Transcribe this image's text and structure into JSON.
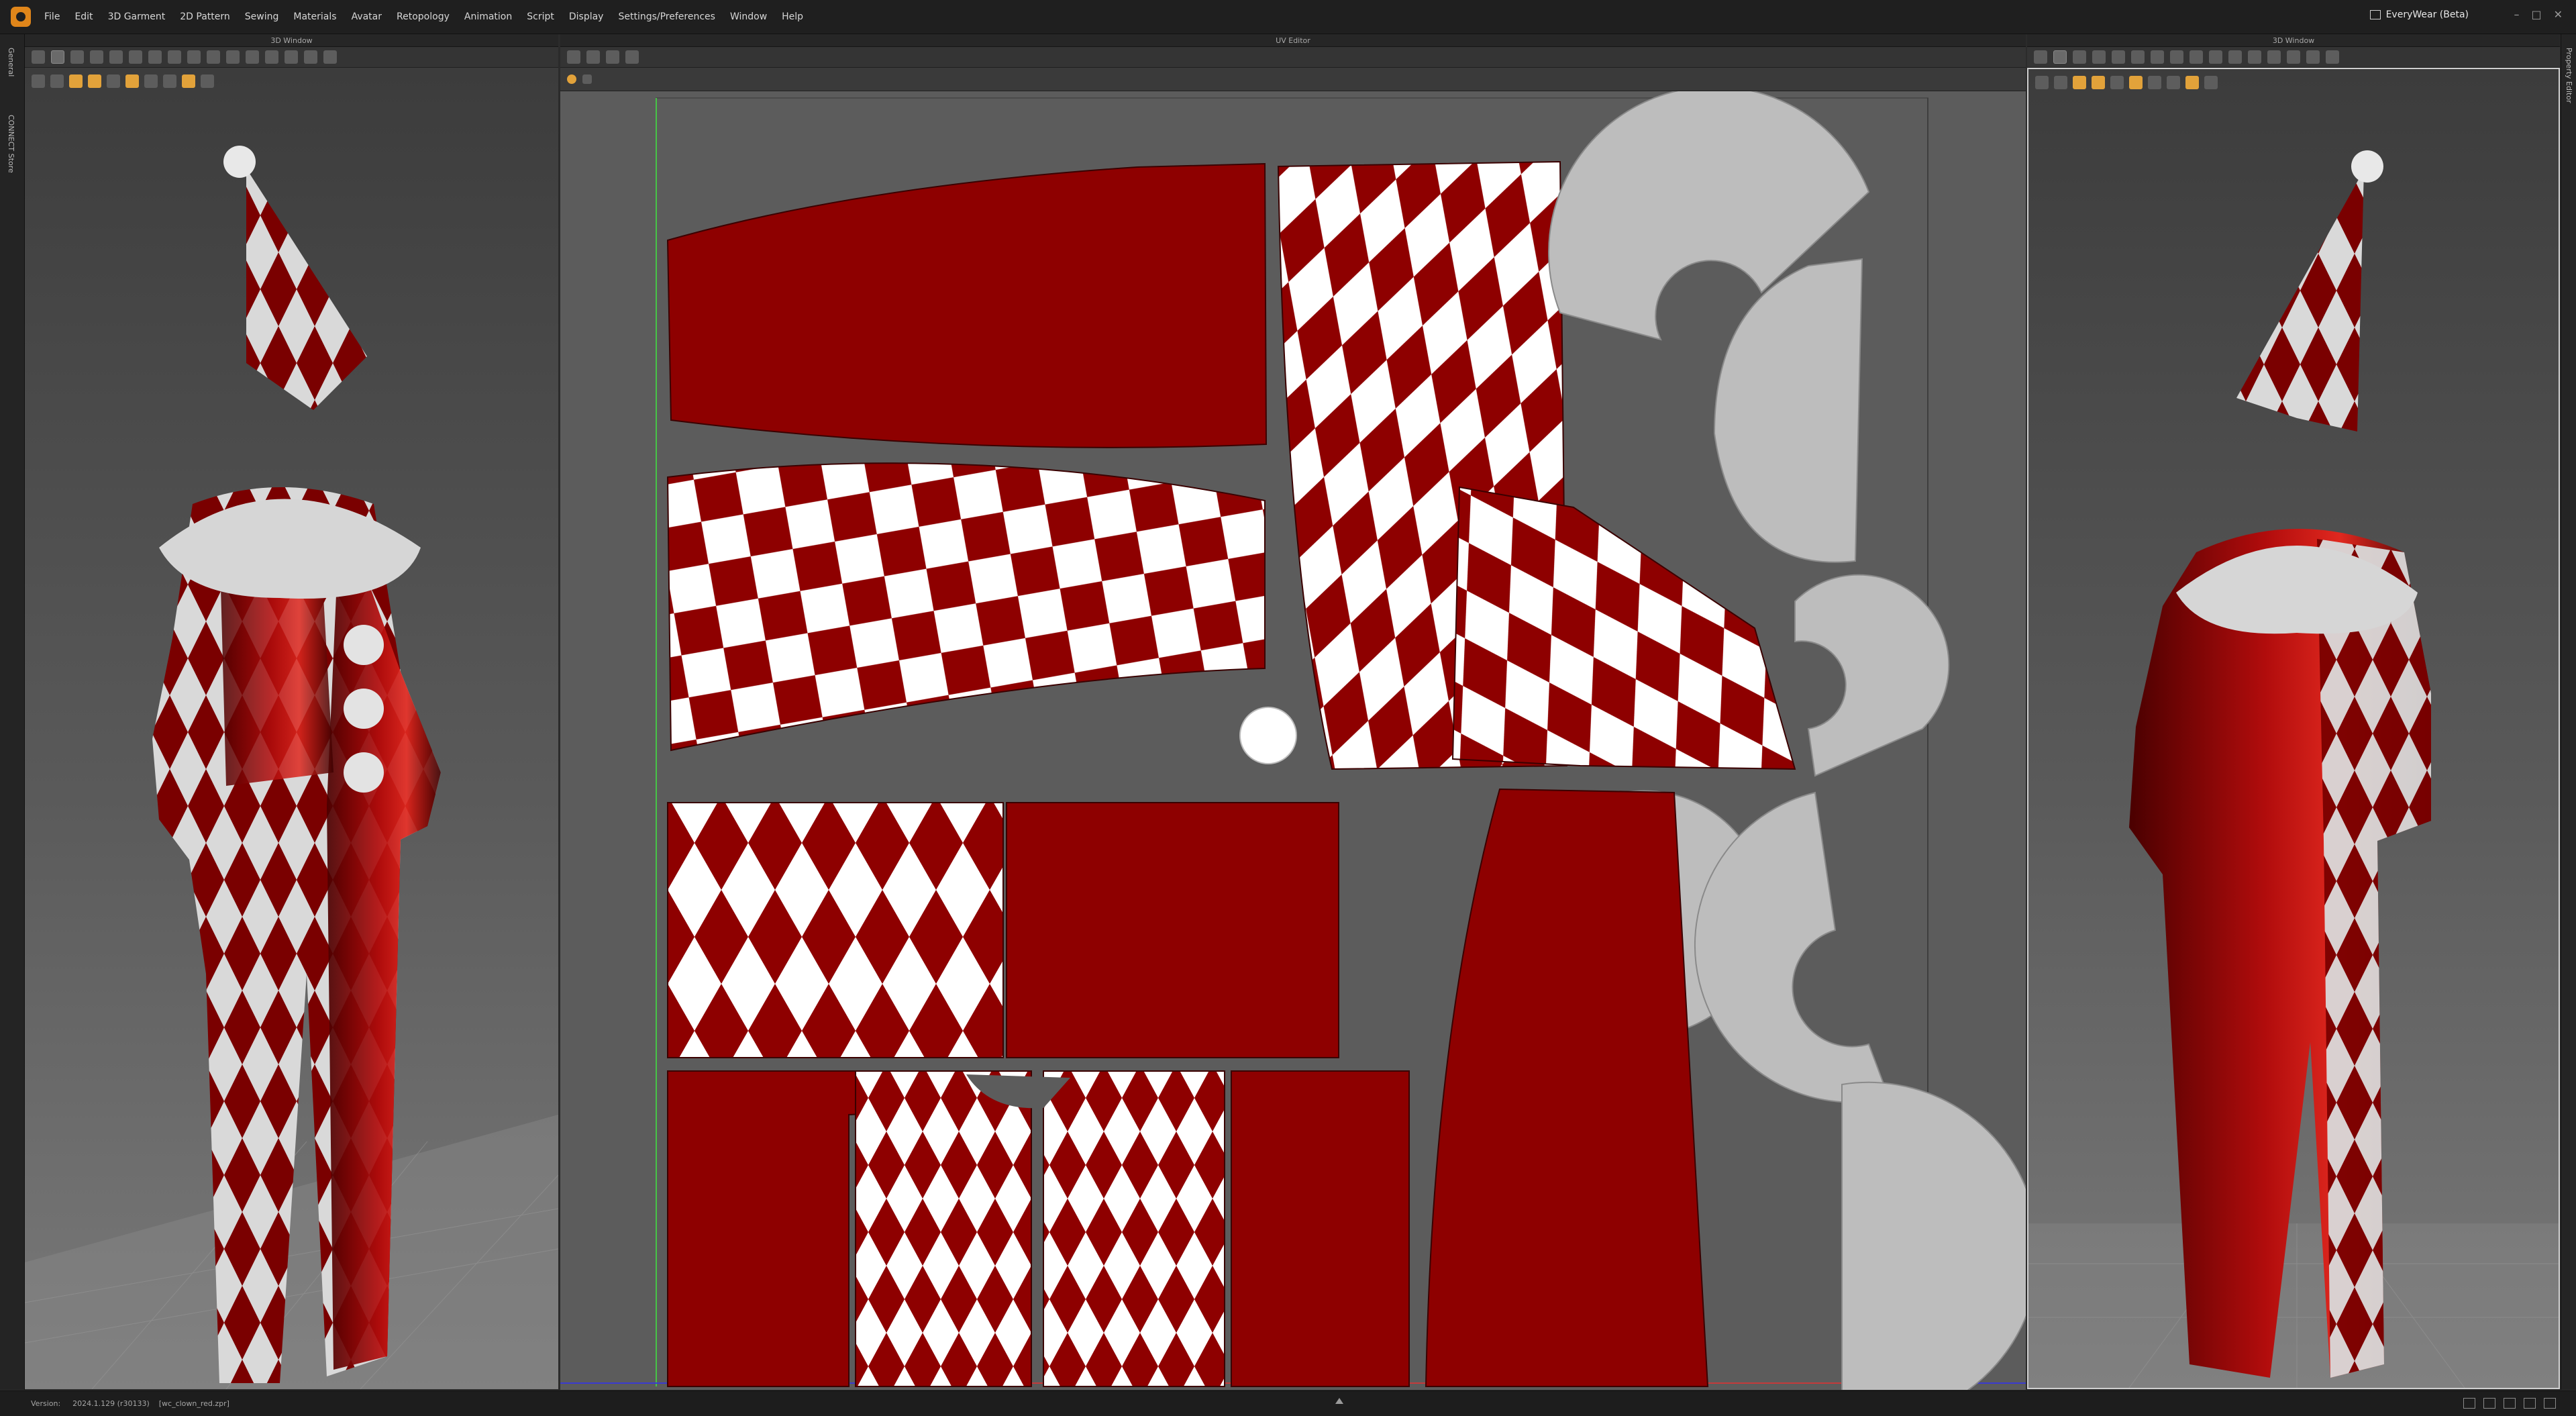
{
  "menu": [
    "File",
    "Edit",
    "3D Garment",
    "2D Pattern",
    "Sewing",
    "Materials",
    "Avatar",
    "Retopology",
    "Animation",
    "Script",
    "Display",
    "Settings/Preferences",
    "Window",
    "Help"
  ],
  "workspace_label": "EveryWear (Beta)",
  "window_controls": [
    "–",
    "□",
    "✕"
  ],
  "left_tabs": [
    "General",
    "CONNECT Store"
  ],
  "right_tabs": [
    "Property Editor"
  ],
  "panels": {
    "left_3d": {
      "title": "3D Window"
    },
    "uv": {
      "title": "UV Editor"
    },
    "right_3d": {
      "title": "3D Window"
    }
  },
  "status": {
    "version_label": "Version:",
    "version_value": "2024.1.129 (r30133)",
    "file_name": "[wc_clown_red.zpr]"
  },
  "icons": {
    "app": "marvelous-designer-logo",
    "workspace": "workspace-icon"
  },
  "colors": {
    "fabric_red": "#8e0000",
    "fabric_white": "#ffffff",
    "collar_white": "#c9c9c9",
    "uv_background": "#5c5c5c",
    "uv_tile_border": "#47c447",
    "accent_orange": "#e0861a"
  }
}
